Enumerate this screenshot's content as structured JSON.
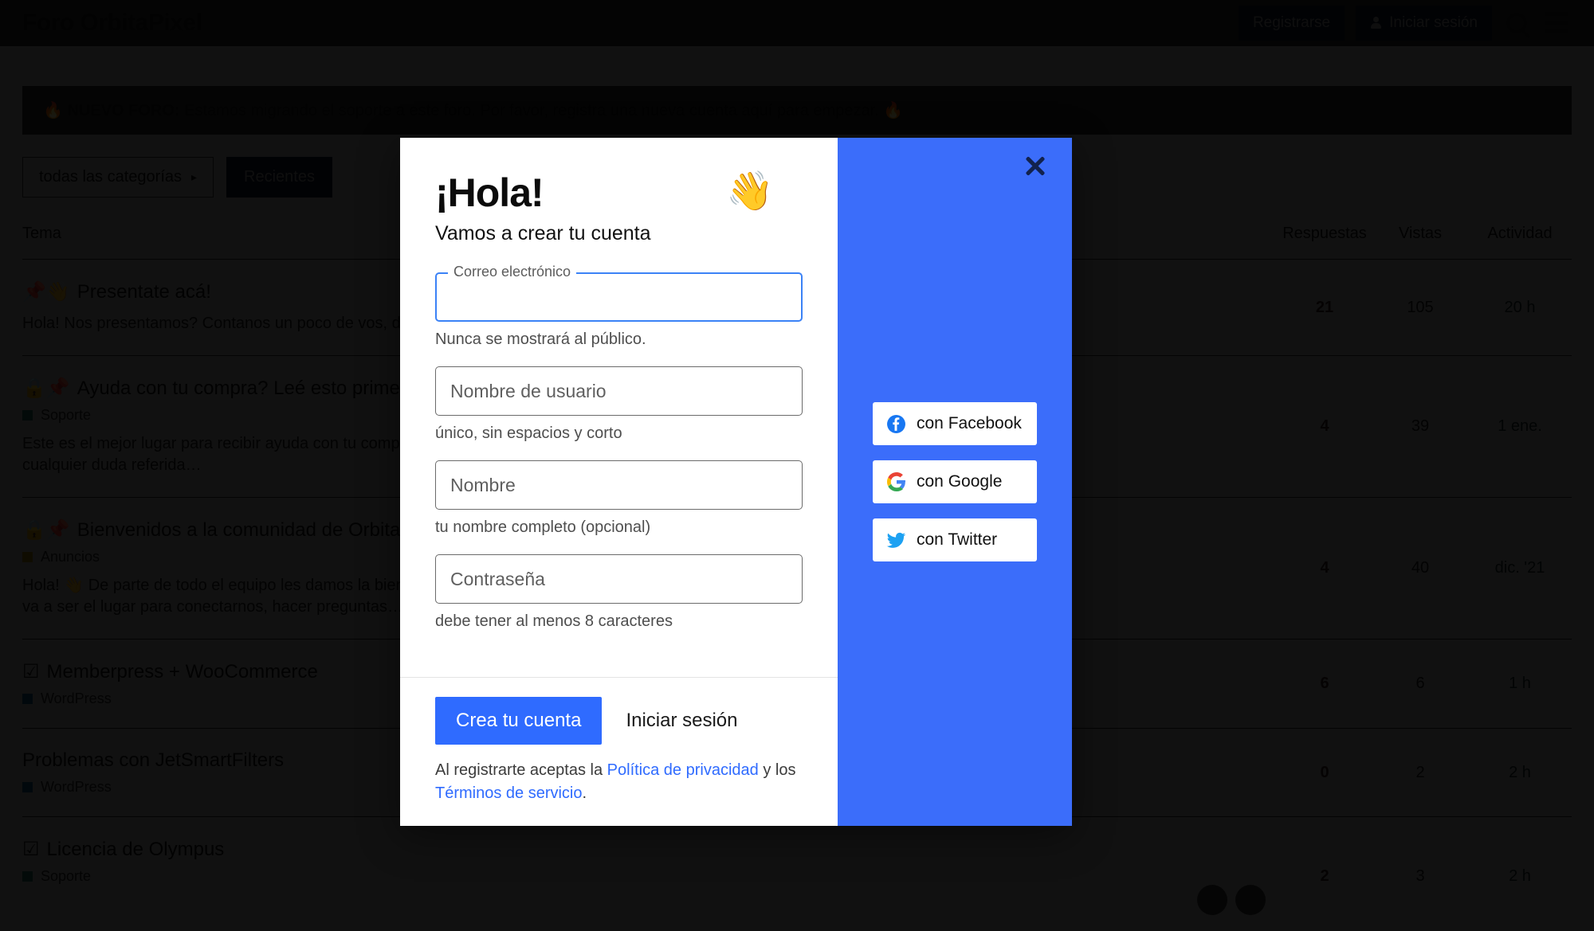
{
  "header": {
    "brand": "Foro OrbitaPixel",
    "register_label": "Registrarse",
    "login_label": "Iniciar sesión",
    "search_icon": "search-icon",
    "menu_icon": "hamburger-menu-icon"
  },
  "notice": {
    "flame_left": "🔥",
    "strong": "NUEVO FORO:",
    "text": " Estamos migrando el soporte a este foro. Por favor, registra una nueva cuenta aquí para empezar. ",
    "flame_right": "🔥"
  },
  "controls": {
    "category_label": "todas las categorías",
    "category_caret": "▸",
    "sort_label": "Recientes"
  },
  "table": {
    "columns": [
      "Tema",
      "Respuestas",
      "Vistas",
      "Actividad"
    ],
    "rows": [
      {
        "icons": "📌👋",
        "title": "Presentate acá!",
        "category": "",
        "category_color": "",
        "excerpt": "Hola! Nos presentamos? Contanos un poco de vos, de tu trabajo y lo que quieras compartir con nosotros 😄",
        "replies": "21",
        "views": "105",
        "activity": "20 h",
        "avatars": 0
      },
      {
        "icons": "🔒📌",
        "title": "Ayuda con tu compra? Leé esto primero",
        "category": "Soporte",
        "category_color": "#1f6b5e",
        "excerpt": "Este es el mejor lugar para recibir ayuda con tu compra. Acá podes reportar fallos con la instalación, updates, y cualquier duda referida…",
        "replies": "4",
        "views": "39",
        "activity": "1 ene.",
        "avatars": 0
      },
      {
        "icons": "🔒📌",
        "title": "Bienvenidos a la comunidad de OrbitaPixel",
        "category": "Anuncios",
        "category_color": "#9a7d10",
        "excerpt": "Hola! 👋 De parte de todo el equipo les damos la bienvenida a este espacio para toda nuestra comunidad. Este va a ser el lugar para conectarnos, hacer preguntas…",
        "replies": "4",
        "views": "40",
        "activity": "dic. '21",
        "avatars": 0
      },
      {
        "icons": "☑",
        "title": "Memberpress + WooCommerce",
        "category": "WordPress",
        "category_color": "#14507a",
        "excerpt": "",
        "replies": "6",
        "views": "6",
        "activity": "1 h",
        "avatars": 0
      },
      {
        "icons": "",
        "title": "Problemas con JetSmartFilters",
        "category": "WordPress",
        "category_color": "#14507a",
        "excerpt": "",
        "replies": "0",
        "views": "2",
        "activity": "2 h",
        "avatars": 0
      },
      {
        "icons": "☑",
        "title": "Licencia de Olympus",
        "category": "Soporte",
        "category_color": "#1f6b5e",
        "excerpt": "",
        "replies": "2",
        "views": "3",
        "activity": "2 h",
        "avatars": 2
      }
    ]
  },
  "modal": {
    "heading": "¡Hola!",
    "subheading": "Vamos a crear tu cuenta",
    "wave_emoji": "👋",
    "close_icon": "close-icon",
    "email": {
      "label": "Correo electrónico",
      "value": "",
      "hint": "Nunca se mostrará al público."
    },
    "username": {
      "placeholder": "Nombre de usuario",
      "value": "",
      "hint": "único, sin espacios y corto"
    },
    "name": {
      "placeholder": "Nombre",
      "value": "",
      "hint": "tu nombre completo (opcional)"
    },
    "password": {
      "placeholder": "Contraseña",
      "value": "",
      "hint": "debe tener al menos 8 caracteres"
    },
    "submit_label": "Crea tu cuenta",
    "login_label": "Iniciar sesión",
    "terms": {
      "prefix": "Al registrarte aceptas la ",
      "privacy_link": "Política de privacidad",
      "middle": " y los ",
      "terms_link": "Términos de servicio",
      "suffix": "."
    },
    "social": {
      "facebook": "con Facebook",
      "google": "con Google",
      "twitter": "con Twitter"
    },
    "accent_color": "#3b6dfa",
    "primary_button_color": "#2f6bff"
  }
}
